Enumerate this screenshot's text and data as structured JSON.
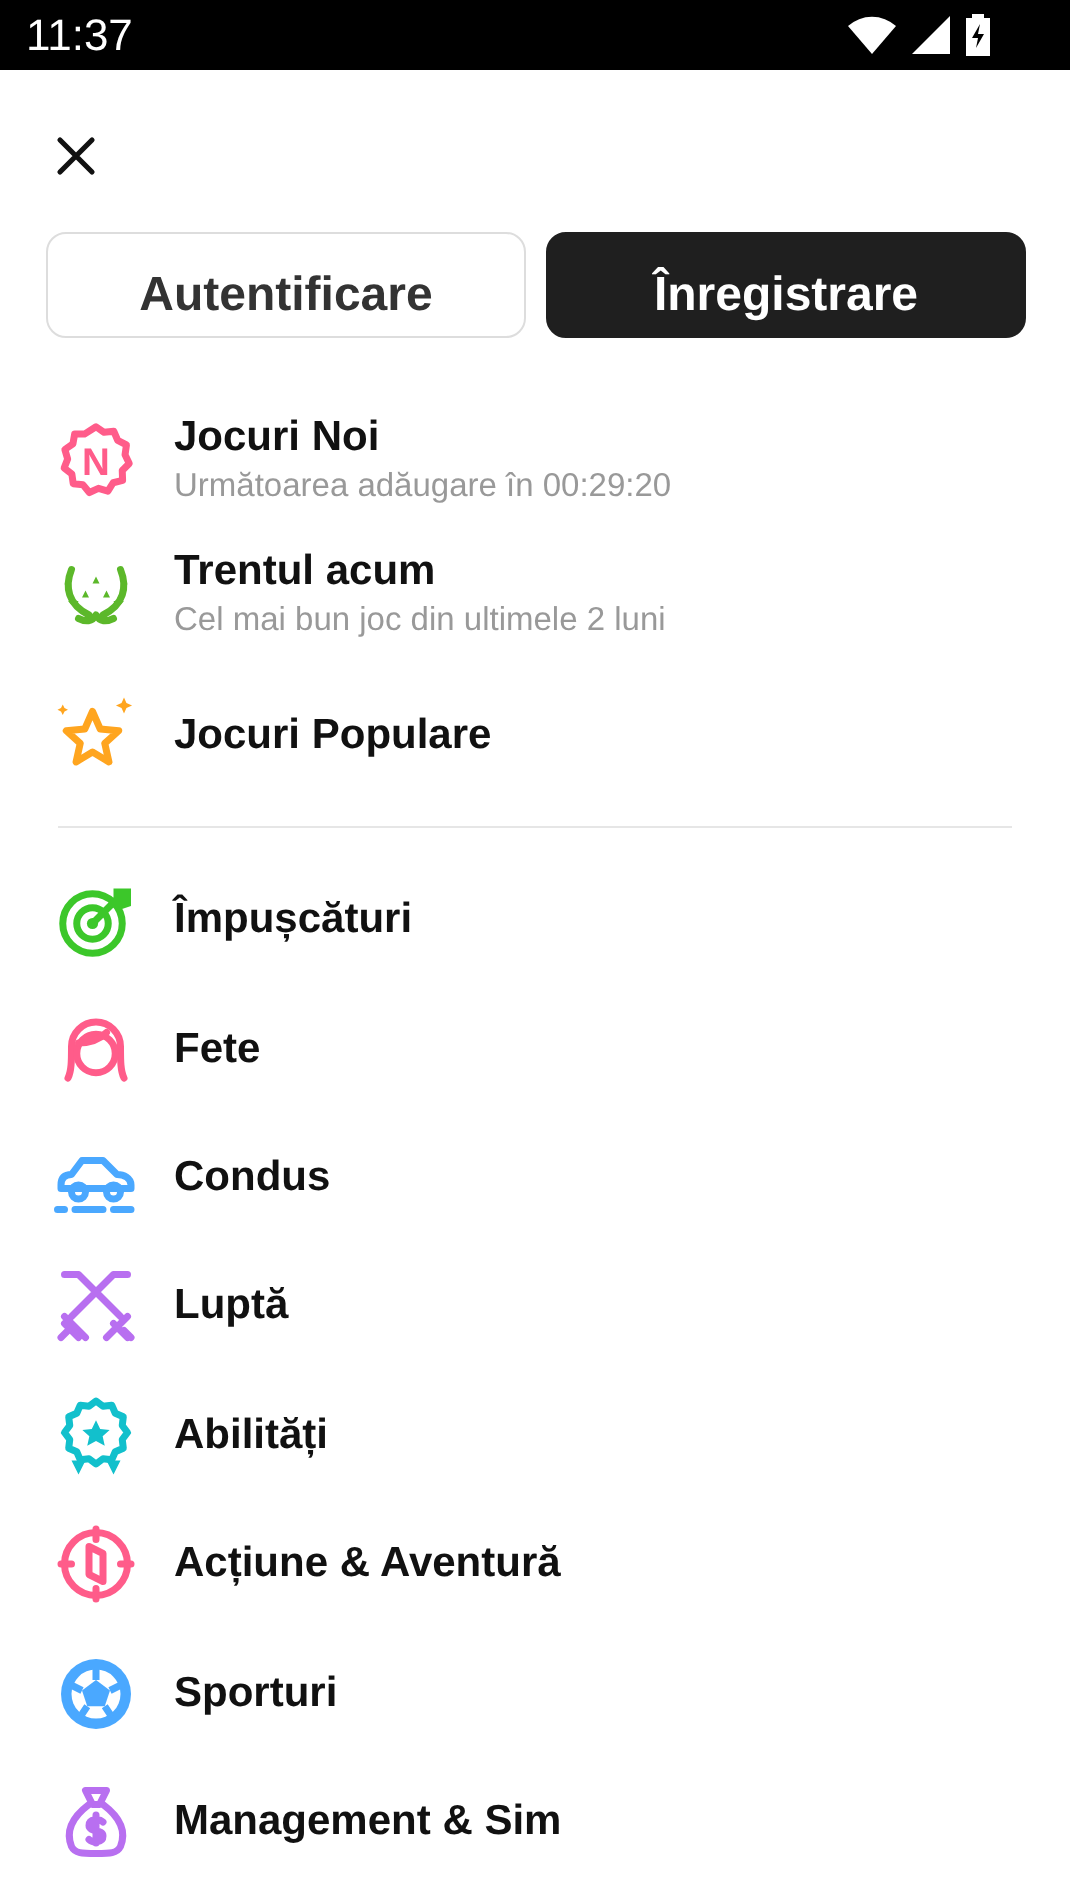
{
  "status_bar": {
    "time": "11:37"
  },
  "auth_buttons": [
    {
      "label": "Autentificare",
      "kind": "outline"
    },
    {
      "label": "Înregistrare",
      "kind": "filled"
    }
  ],
  "featured": [
    {
      "title": "Jocuri Noi",
      "subtitle": "Următoarea adăugare în 00:29:20",
      "kind": "badge",
      "badge": "N",
      "color": "#ff5c8a"
    },
    {
      "title": "Trentul acum",
      "subtitle": "Cel mai bun joc din ultimele 2 luni",
      "kind": "laurel",
      "color": "#5cb82a"
    },
    {
      "title": "Jocuri Populare",
      "kind": "star",
      "color": "#ffa51f"
    }
  ],
  "categories": [
    {
      "title": "Împușcături",
      "kind": "target",
      "color": "#3cc72a"
    },
    {
      "title": "Fete",
      "kind": "girl",
      "color": "#ff5c8a"
    },
    {
      "title": "Condus",
      "kind": "car",
      "color": "#4aa8ff"
    },
    {
      "title": "Luptă",
      "kind": "swords",
      "color": "#b86ff0"
    },
    {
      "title": "Abilități",
      "kind": "award",
      "color": "#12c0cc"
    },
    {
      "title": "Acțiune & Aventură",
      "kind": "compass",
      "color": "#ff5c8a"
    },
    {
      "title": "Sporturi",
      "kind": "ball",
      "color": "#4aa8ff"
    },
    {
      "title": "Management & Sim",
      "kind": "moneybag",
      "color": "#b86ff0"
    }
  ]
}
